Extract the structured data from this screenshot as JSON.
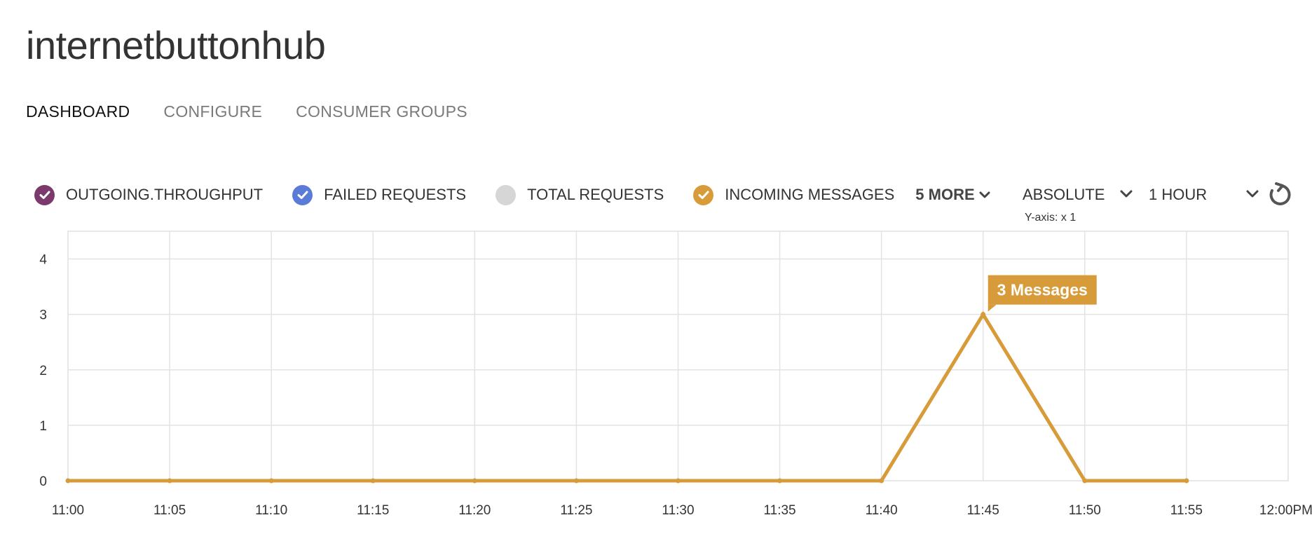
{
  "header": {
    "title": "internetbuttonhub"
  },
  "tabs": [
    {
      "label": "DASHBOARD",
      "active": true
    },
    {
      "label": "CONFIGURE",
      "active": false
    },
    {
      "label": "CONSUMER GROUPS",
      "active": false
    }
  ],
  "legend": {
    "items": [
      {
        "label": "OUTGOING.THROUGHPUT",
        "color": "#7b3a6b",
        "checked": true,
        "icon": "check-circle-icon"
      },
      {
        "label": "FAILED REQUESTS",
        "color": "#5b7bd9",
        "checked": true,
        "icon": "check-circle-icon"
      },
      {
        "label": "TOTAL REQUESTS",
        "color": "#d6d6d6",
        "checked": false,
        "icon": "circle-icon"
      },
      {
        "label": "INCOMING MESSAGES",
        "color": "#d89b3a",
        "checked": true,
        "icon": "check-circle-icon"
      }
    ],
    "more_label": "5 MORE"
  },
  "controls": {
    "scale_label": "ABSOLUTE",
    "range_label": "1 HOUR",
    "yaxis_note": "Y-axis: x 1",
    "refresh_icon": "refresh-icon"
  },
  "chart_data": {
    "type": "line",
    "x": [
      "11:00",
      "11:05",
      "11:10",
      "11:15",
      "11:20",
      "11:25",
      "11:30",
      "11:35",
      "11:40",
      "11:45",
      "11:50",
      "11:55",
      "12:00PM"
    ],
    "series": [
      {
        "name": "INCOMING MESSAGES",
        "color": "#d89b3a",
        "values": [
          0,
          0,
          0,
          0,
          0,
          0,
          0,
          0,
          0,
          3,
          0,
          0
        ]
      }
    ],
    "yticks": [
      "0",
      "1",
      "2",
      "3",
      "4"
    ],
    "ylim": [
      0,
      4.5
    ],
    "grid": true,
    "tooltip": {
      "text": "3 Messages",
      "series": "INCOMING MESSAGES",
      "x": "11:45",
      "y": 3
    }
  }
}
